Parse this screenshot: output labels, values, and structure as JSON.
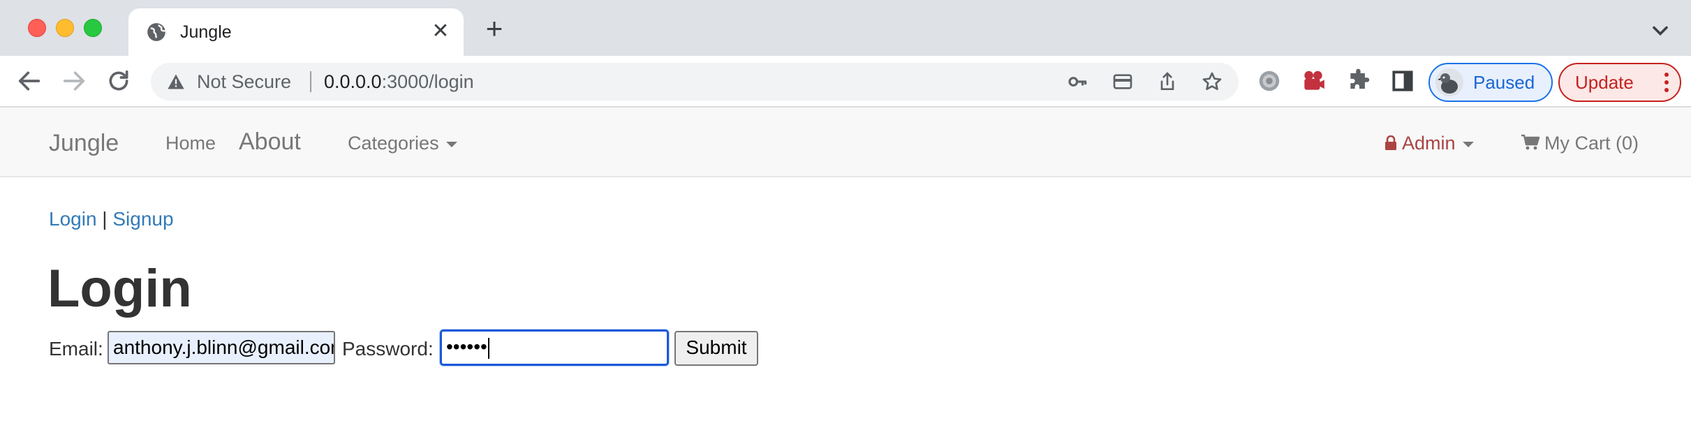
{
  "browser": {
    "tab": {
      "title": "Jungle",
      "close_glyph": "✕"
    },
    "new_tab_glyph": "+",
    "address": {
      "security_label": "Not Secure",
      "host": "0.0.0.0",
      "path": ":3000/login"
    },
    "profile": {
      "label": "Paused"
    },
    "update": {
      "label": "Update"
    },
    "colors": {
      "accent": "#1a73e8",
      "update": "#c5221f"
    }
  },
  "navbar": {
    "brand": "Jungle",
    "links": {
      "home": "Home",
      "about": "About",
      "categories": "Categories"
    },
    "admin": "Admin",
    "cart": "My Cart (0)"
  },
  "page": {
    "auth": {
      "login": "Login",
      "separator": "|",
      "signup": "Signup"
    },
    "heading": "Login",
    "form": {
      "email_label": "Email:",
      "email_value": "anthony.j.blinn@gmail.com",
      "password_label": "Password:",
      "password_mask": "••••••",
      "submit_label": "Submit"
    },
    "colors": {
      "link": "#337ab7",
      "admin": "#a94442"
    }
  }
}
